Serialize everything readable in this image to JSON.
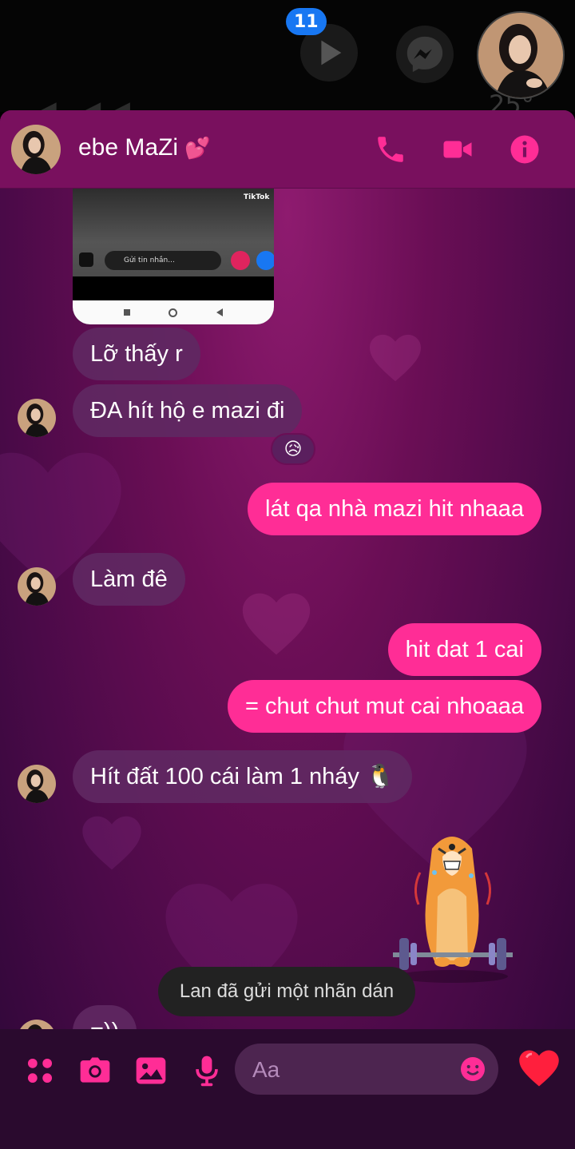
{
  "topbar": {
    "badge_count": "11",
    "icons": [
      "play-icon",
      "messenger-icon"
    ]
  },
  "header": {
    "contact_name": "ebe MaZi",
    "name_emoji": "💕",
    "actions": [
      "phone-icon",
      "video-icon",
      "info-icon"
    ]
  },
  "shared_image": {
    "app_label": "TikTok",
    "input_text": "Gửi tin nhắn..."
  },
  "messages": [
    {
      "side": "in",
      "text": "Lỡ thấy r"
    },
    {
      "side": "in",
      "text": "ĐA hít hộ e mazi đi",
      "reaction": "😥"
    },
    {
      "side": "out",
      "text": "lát qa nhà mazi hit nhaaa"
    },
    {
      "side": "in",
      "text": "Làm đê"
    },
    {
      "side": "out",
      "text": "hit dat 1 cai"
    },
    {
      "side": "out",
      "text": "= chut chut mut cai nhoaaa"
    },
    {
      "side": "in",
      "text": "Hít đất 100 cái làm 1 nháy 🐧"
    },
    {
      "side": "out",
      "type": "sticker",
      "sticker": "dog-lifting-barbell"
    },
    {
      "side": "in",
      "text": "=))"
    }
  ],
  "toast": "Lan đã gửi một nhãn dán",
  "composer": {
    "placeholder": "Aa",
    "icons": [
      "menu-dots-icon",
      "camera-icon",
      "image-icon",
      "mic-icon",
      "emoji-icon",
      "heart-icon"
    ]
  },
  "colors": {
    "accent": "#ff2d96",
    "header_bg": "#79105e",
    "incoming_bubble": "#5f2862",
    "composer_bg": "#2a0a2e"
  }
}
